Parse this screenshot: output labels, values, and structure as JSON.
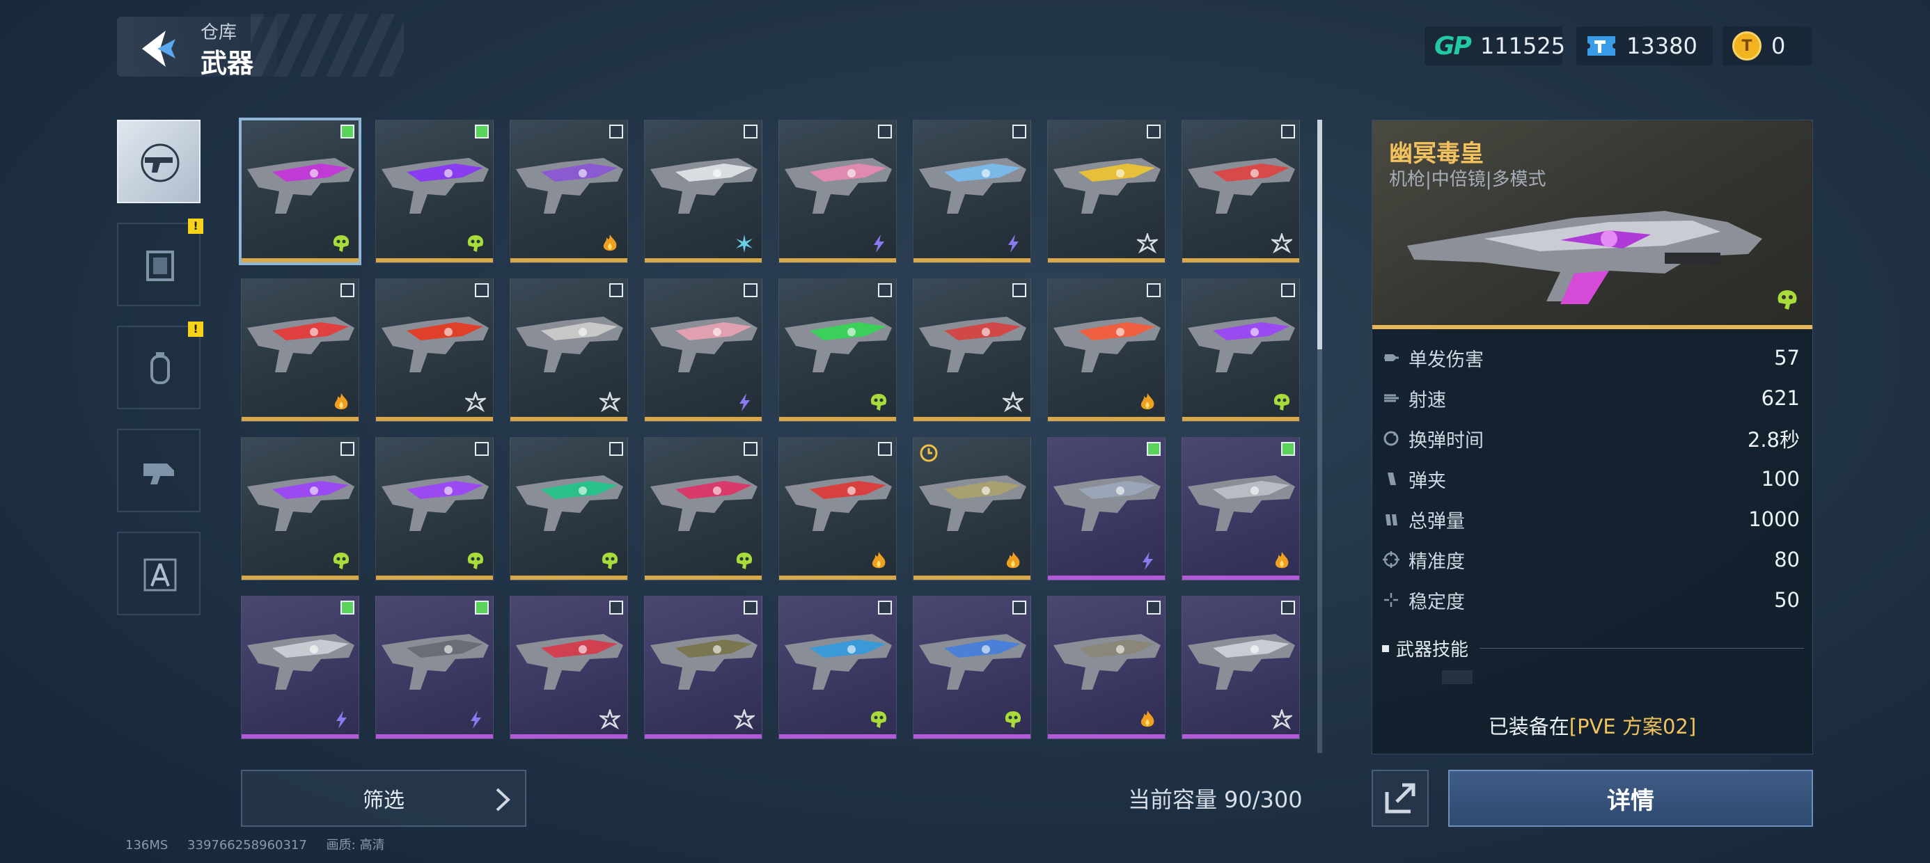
{
  "header": {
    "breadcrumb": "仓库",
    "title": "武器"
  },
  "currencies": [
    {
      "name": "GP",
      "icon": "gp-icon",
      "value": "111525"
    },
    {
      "name": "tm",
      "icon": "ticket-icon",
      "value": "13380"
    },
    {
      "name": "coin",
      "icon": "coin-icon",
      "value": "0"
    }
  ],
  "categories": [
    {
      "name": "weapons",
      "icon": "pistol-icon",
      "active": true,
      "badge": ""
    },
    {
      "name": "frames",
      "icon": "frame-icon",
      "active": false,
      "badge": "!"
    },
    {
      "name": "grenades",
      "icon": "grenade-icon",
      "active": false,
      "badge": "!"
    },
    {
      "name": "parts",
      "icon": "parts-icon",
      "active": false,
      "badge": ""
    },
    {
      "name": "blueprints",
      "icon": "blueprint-icon",
      "active": false,
      "badge": ""
    }
  ],
  "weapons": [
    {
      "rarity": "gold",
      "checked": true,
      "selected": true,
      "element": "poison",
      "color": "#c03ad6"
    },
    {
      "rarity": "gold",
      "checked": true,
      "element": "poison",
      "color": "#8a3df0"
    },
    {
      "rarity": "gold",
      "checked": false,
      "element": "fire",
      "color": "#8c5ad0"
    },
    {
      "rarity": "gold",
      "checked": false,
      "element": "ice",
      "color": "#d8dde2"
    },
    {
      "rarity": "gold",
      "checked": false,
      "element": "lightning",
      "color": "#e08ab0"
    },
    {
      "rarity": "gold",
      "checked": false,
      "element": "lightning",
      "color": "#7ab8e8"
    },
    {
      "rarity": "gold",
      "checked": false,
      "element": "frost",
      "color": "#e6c03a"
    },
    {
      "rarity": "gold",
      "checked": false,
      "element": "frost",
      "color": "#d84a4a"
    },
    {
      "rarity": "gold",
      "checked": false,
      "element": "fire",
      "color": "#e04040"
    },
    {
      "rarity": "gold",
      "checked": false,
      "element": "frost",
      "color": "#e0402a"
    },
    {
      "rarity": "gold",
      "checked": false,
      "element": "frost",
      "color": "#c8c8c8"
    },
    {
      "rarity": "gold",
      "checked": false,
      "element": "lightning",
      "color": "#e0a0b0"
    },
    {
      "rarity": "gold",
      "checked": false,
      "element": "poison",
      "color": "#3ad05a"
    },
    {
      "rarity": "gold",
      "checked": false,
      "element": "frost",
      "color": "#d04848"
    },
    {
      "rarity": "gold",
      "checked": false,
      "element": "fire",
      "color": "#f06040"
    },
    {
      "rarity": "gold",
      "checked": false,
      "element": "poison",
      "color": "#9a4af0"
    },
    {
      "rarity": "gold",
      "checked": false,
      "element": "poison",
      "color": "#9a4af0"
    },
    {
      "rarity": "gold",
      "checked": false,
      "element": "poison",
      "color": "#9a4af0"
    },
    {
      "rarity": "gold",
      "checked": false,
      "element": "poison",
      "color": "#2ac08a"
    },
    {
      "rarity": "gold",
      "checked": false,
      "element": "poison",
      "color": "#d83a6a"
    },
    {
      "rarity": "gold",
      "checked": false,
      "element": "fire",
      "color": "#d84040"
    },
    {
      "rarity": "gold",
      "checked": false,
      "element": "fire",
      "color": "#a8a070",
      "clock": true
    },
    {
      "rarity": "purple",
      "checked": true,
      "element": "lightning",
      "color": "#9aa6b8"
    },
    {
      "rarity": "purple",
      "checked": true,
      "element": "fire",
      "color": "#b8bcc4"
    },
    {
      "rarity": "purple",
      "checked": true,
      "element": "lightning",
      "color": "#c8ccd2"
    },
    {
      "rarity": "purple",
      "checked": true,
      "element": "lightning",
      "color": "#6a6e74"
    },
    {
      "rarity": "purple",
      "checked": false,
      "element": "frost",
      "color": "#d04050"
    },
    {
      "rarity": "purple",
      "checked": false,
      "element": "frost",
      "color": "#7a7650"
    },
    {
      "rarity": "purple",
      "checked": false,
      "element": "poison",
      "color": "#3a9ad8"
    },
    {
      "rarity": "purple",
      "checked": false,
      "element": "poison",
      "color": "#4a80d8"
    },
    {
      "rarity": "purple",
      "checked": false,
      "element": "fire",
      "color": "#8a8678"
    },
    {
      "rarity": "purple",
      "checked": false,
      "element": "frost",
      "color": "#c8ccd4"
    }
  ],
  "filter": {
    "label": "筛选"
  },
  "capacity": {
    "label": "当前容量",
    "value": "90/300"
  },
  "footer": {
    "ping": "136MS",
    "uid": "339766258960317",
    "quality_label": "画质:",
    "quality": "高清"
  },
  "detail": {
    "name": "幽冥毒皇",
    "subtitle": "机枪|中倍镜|多模式",
    "element": "poison",
    "stats": [
      {
        "label": "单发伤害",
        "value": "57",
        "icon": "bullet-icon"
      },
      {
        "label": "射速",
        "value": "621",
        "icon": "fire-rate-icon"
      },
      {
        "label": "换弹时间",
        "value": "2.8秒",
        "icon": "reload-icon"
      },
      {
        "label": "弹夹",
        "value": "100",
        "icon": "magazine-icon"
      },
      {
        "label": "总弹量",
        "value": "1000",
        "icon": "ammo-icon"
      },
      {
        "label": "精准度",
        "value": "80",
        "icon": "crosshair-icon"
      },
      {
        "label": "稳定度",
        "value": "50",
        "icon": "stability-icon"
      }
    ],
    "skills_label": "武器技能",
    "equipped_prefix": "已装备在",
    "equipped_plan": "[PVE 方案02]",
    "detail_button": "详情"
  },
  "colors": {
    "gold": "#d9a84a",
    "purple": "#b35ad8",
    "accent": "#f2c25e",
    "poison": "#9ad43a"
  }
}
